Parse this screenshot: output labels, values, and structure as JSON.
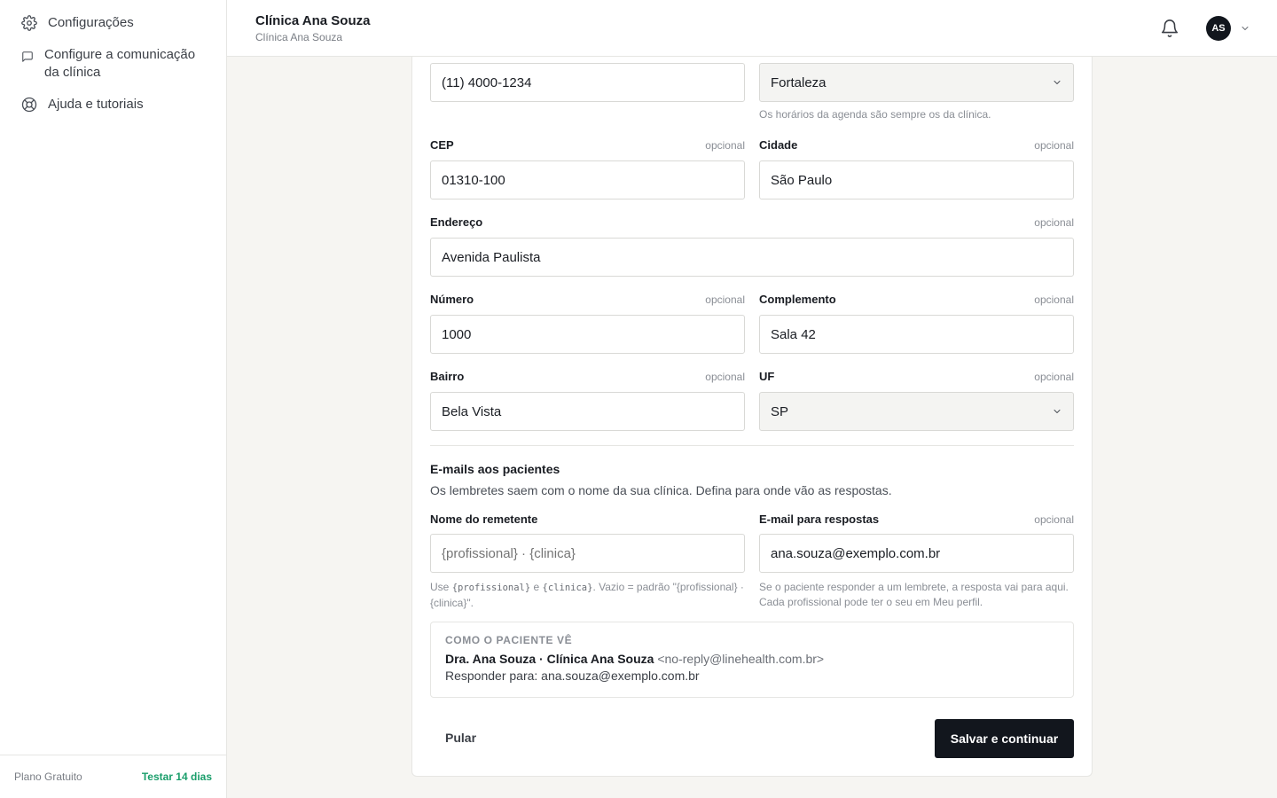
{
  "sidebar": {
    "items": [
      {
        "label": "Configurações",
        "icon": "gear-icon"
      },
      {
        "label": "Configure a comunicação da clínica",
        "icon": "message-icon"
      },
      {
        "label": "Ajuda e tutoriais",
        "icon": "lifebuoy-icon"
      }
    ],
    "footer": {
      "plan": "Plano Gratuito",
      "trial": "Testar 14 dias"
    }
  },
  "header": {
    "title": "Clínica Ana Souza",
    "subtitle": "Clínica Ana Souza",
    "avatar_initials": "AS",
    "bell_icon": "bell-icon"
  },
  "form": {
    "phone": {
      "value": "(11) 4000-1234"
    },
    "timezone": {
      "value": "Fortaleza",
      "hint": "Os horários da agenda são sempre os da clínica."
    },
    "cep": {
      "label": "CEP",
      "optional": "opcional",
      "value": "01310-100"
    },
    "city": {
      "label": "Cidade",
      "optional": "opcional",
      "value": "São Paulo"
    },
    "address": {
      "label": "Endereço",
      "optional": "opcional",
      "value": "Avenida Paulista"
    },
    "number": {
      "label": "Número",
      "optional": "opcional",
      "value": "1000"
    },
    "complement": {
      "label": "Complemento",
      "optional": "opcional",
      "value": "Sala 42"
    },
    "district": {
      "label": "Bairro",
      "optional": "opcional",
      "value": "Bela Vista"
    },
    "uf": {
      "label": "UF",
      "optional": "opcional",
      "value": "SP"
    }
  },
  "emails": {
    "title": "E-mails aos pacientes",
    "description": "Os lembretes saem com o nome da sua clínica. Defina para onde vão as respostas.",
    "sender": {
      "label": "Nome do remetente",
      "placeholder": "{profissional} · {clinica}",
      "value": "",
      "hint_prefix": "Use ",
      "hint_code1": "{profissional}",
      "hint_mid": " e ",
      "hint_code2": "{clinica}",
      "hint_suffix": ". Vazio = padrão \"{profissional} · {clinica}\"."
    },
    "reply": {
      "label": "E-mail para respostas",
      "optional": "opcional",
      "value": "ana.souza@exemplo.com.br",
      "hint": "Se o paciente responder a um lembrete, a resposta vai para aqui. Cada profissional pode ter o seu em Meu perfil."
    },
    "preview": {
      "title": "COMO O PACIENTE VÊ",
      "from_name": "Dra. Ana Souza · Clínica Ana Souza",
      "from_address": "<no-reply@linehealth.com.br>",
      "reply_to": "Responder para: ana.souza@exemplo.com.br"
    }
  },
  "actions": {
    "skip": "Pular",
    "save": "Salvar e continuar"
  }
}
